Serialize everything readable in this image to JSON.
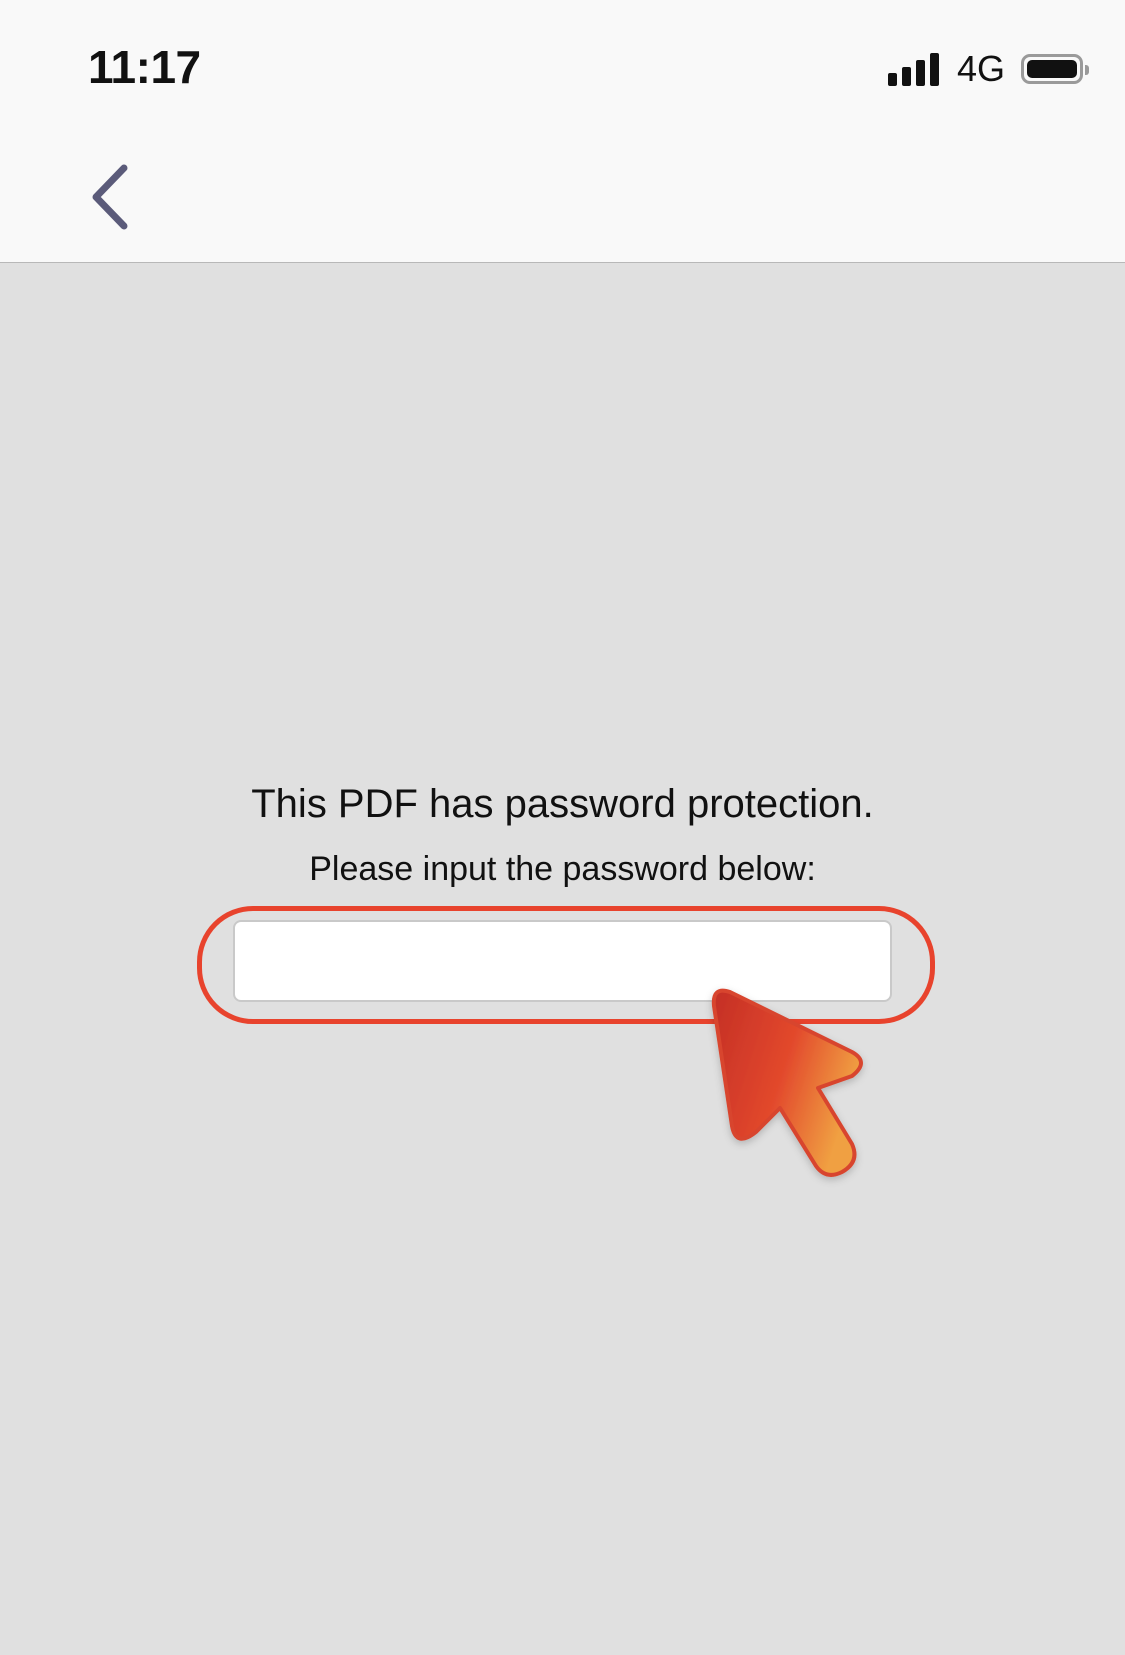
{
  "status_bar": {
    "time": "11:17",
    "network": "4G",
    "signal_bars": 4,
    "battery_level": 0.9
  },
  "nav": {
    "back_icon": "chevron-left-icon"
  },
  "password_prompt": {
    "title": "This PDF has password protection.",
    "subtitle": "Please input the password below:",
    "input_value": "",
    "input_placeholder": ""
  },
  "annotation": {
    "highlight_color": "#e8432d",
    "pointer_icon": "arrow-pointer-icon"
  },
  "colors": {
    "background": "#e0e0e0",
    "nav_background": "#f9f9f9",
    "back_chevron": "#5b5b7a"
  }
}
